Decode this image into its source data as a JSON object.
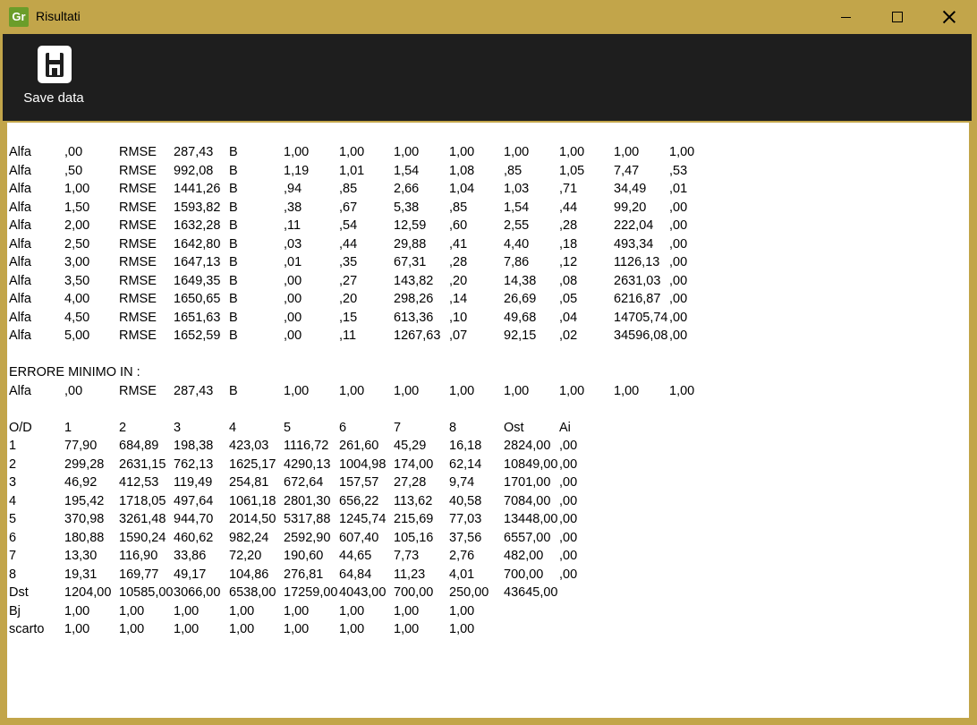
{
  "window": {
    "icon_text": "Gr",
    "title": "Risultati",
    "controls": [
      "minimize",
      "maximize",
      "close"
    ]
  },
  "toolbar": {
    "save_label": "Save data",
    "save_icon": "floppy-disk-icon"
  },
  "results": {
    "rows": [
      [
        "Alfa",
        ",00",
        "RMSE",
        "287,43",
        "B",
        "1,00",
        "1,00",
        "1,00",
        "1,00",
        "1,00",
        "1,00",
        "1,00",
        "1,00"
      ],
      [
        "Alfa",
        ",50",
        "RMSE",
        "992,08",
        "B",
        "1,19",
        "1,01",
        "1,54",
        "1,08",
        ",85",
        "1,05",
        "7,47",
        ",53"
      ],
      [
        "Alfa",
        "1,00",
        "RMSE",
        "1441,26",
        "B",
        ",94",
        ",85",
        "2,66",
        "1,04",
        "1,03",
        ",71",
        "34,49",
        ",01"
      ],
      [
        "Alfa",
        "1,50",
        "RMSE",
        "1593,82",
        "B",
        ",38",
        ",67",
        "5,38",
        ",85",
        "1,54",
        ",44",
        "99,20",
        ",00"
      ],
      [
        "Alfa",
        "2,00",
        "RMSE",
        "1632,28",
        "B",
        ",11",
        ",54",
        "12,59",
        ",60",
        "2,55",
        ",28",
        "222,04",
        ",00"
      ],
      [
        "Alfa",
        "2,50",
        "RMSE",
        "1642,80",
        "B",
        ",03",
        ",44",
        "29,88",
        ",41",
        "4,40",
        ",18",
        "493,34",
        ",00"
      ],
      [
        "Alfa",
        "3,00",
        "RMSE",
        "1647,13",
        "B",
        ",01",
        ",35",
        "67,31",
        ",28",
        "7,86",
        ",12",
        "1126,13",
        ",00"
      ],
      [
        "Alfa",
        "3,50",
        "RMSE",
        "1649,35",
        "B",
        ",00",
        ",27",
        "143,82",
        ",20",
        "14,38",
        ",08",
        "2631,03",
        ",00"
      ],
      [
        "Alfa",
        "4,00",
        "RMSE",
        "1650,65",
        "B",
        ",00",
        ",20",
        "298,26",
        ",14",
        "26,69",
        ",05",
        "6216,87",
        ",00"
      ],
      [
        "Alfa",
        "4,50",
        "RMSE",
        "1651,63",
        "B",
        ",00",
        ",15",
        "613,36",
        ",10",
        "49,68",
        ",04",
        "14705,74",
        ",00"
      ],
      [
        "Alfa",
        "5,00",
        "RMSE",
        "1652,59",
        "B",
        ",00",
        ",11",
        "1267,63",
        ",07",
        "92,15",
        ",02",
        "34596,08",
        ",00"
      ],
      [],
      [
        "ERRORE MINIMO IN :"
      ],
      [
        "Alfa",
        ",00",
        "RMSE",
        "287,43",
        "B",
        "1,00",
        "1,00",
        "1,00",
        "1,00",
        "1,00",
        "1,00",
        "1,00",
        "1,00"
      ],
      [],
      [
        "O/D",
        "1",
        "2",
        "3",
        "4",
        "5",
        "6",
        "7",
        "8",
        "Ost",
        "Ai"
      ],
      [
        "1",
        "77,90",
        "684,89",
        "198,38",
        "423,03",
        "1116,72",
        "261,60",
        "45,29",
        "16,18",
        "2824,00",
        ",00"
      ],
      [
        "2",
        "299,28",
        "2631,15",
        "762,13",
        "1625,17",
        "4290,13",
        "1004,98",
        "174,00",
        "62,14",
        "10849,00",
        ",00"
      ],
      [
        "3",
        "46,92",
        "412,53",
        "119,49",
        "254,81",
        "672,64",
        "157,57",
        "27,28",
        "9,74",
        "1701,00",
        ",00"
      ],
      [
        "4",
        "195,42",
        "1718,05",
        "497,64",
        "1061,18",
        "2801,30",
        "656,22",
        "113,62",
        "40,58",
        "7084,00",
        ",00"
      ],
      [
        "5",
        "370,98",
        "3261,48",
        "944,70",
        "2014,50",
        "5317,88",
        "1245,74",
        "215,69",
        "77,03",
        "13448,00",
        ",00"
      ],
      [
        "6",
        "180,88",
        "1590,24",
        "460,62",
        "982,24",
        "2592,90",
        "607,40",
        "105,16",
        "37,56",
        "6557,00",
        ",00"
      ],
      [
        "7",
        "13,30",
        "116,90",
        "33,86",
        "72,20",
        "190,60",
        "44,65",
        "7,73",
        "2,76",
        "482,00",
        ",00"
      ],
      [
        "8",
        "19,31",
        "169,77",
        "49,17",
        "104,86",
        "276,81",
        "64,84",
        "11,23",
        "4,01",
        "700,00",
        ",00"
      ],
      [
        "Dst",
        "1204,00",
        "10585,00",
        "3066,00",
        "6538,00",
        "17259,00",
        "4043,00",
        "700,00",
        "250,00",
        "43645,00"
      ],
      [
        "Bj",
        "1,00",
        "1,00",
        "1,00",
        "1,00",
        "1,00",
        "1,00",
        "1,00",
        "1,00"
      ],
      [
        "scarto",
        "1,00",
        "1,00",
        "1,00",
        "1,00",
        "1,00",
        "1,00",
        "1,00",
        "1,00"
      ]
    ]
  }
}
